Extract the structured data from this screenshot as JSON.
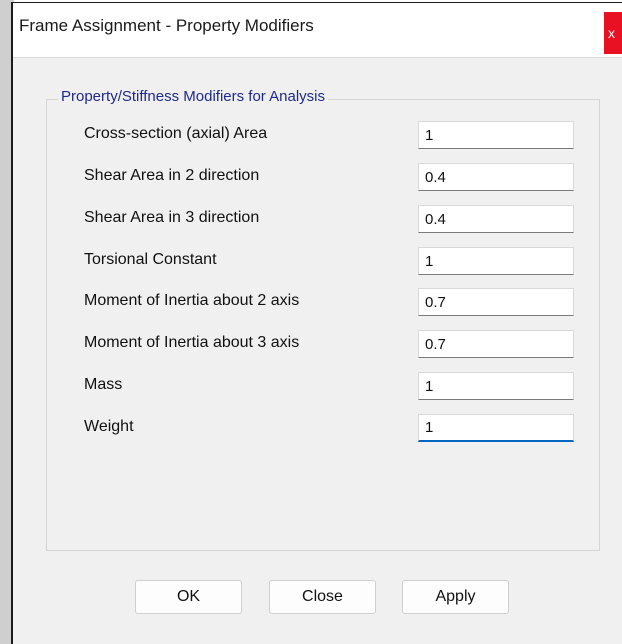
{
  "window": {
    "title": "Frame Assignment - Property Modifiers",
    "close_glyph": "x"
  },
  "group": {
    "label": "Property/Stiffness Modifiers for Analysis"
  },
  "rows": [
    {
      "label": "Cross-section (axial) Area",
      "value": "1"
    },
    {
      "label": "Shear Area in 2 direction",
      "value": "0.4"
    },
    {
      "label": "Shear Area in 3 direction",
      "value": "0.4"
    },
    {
      "label": "Torsional Constant",
      "value": "1"
    },
    {
      "label": "Moment of Inertia about 2 axis",
      "value": "0.7"
    },
    {
      "label": "Moment of Inertia about 3 axis",
      "value": "0.7"
    },
    {
      "label": "Mass",
      "value": "1"
    },
    {
      "label": "Weight",
      "value": "1"
    }
  ],
  "buttons": {
    "ok": "OK",
    "close": "Close",
    "apply": "Apply"
  }
}
